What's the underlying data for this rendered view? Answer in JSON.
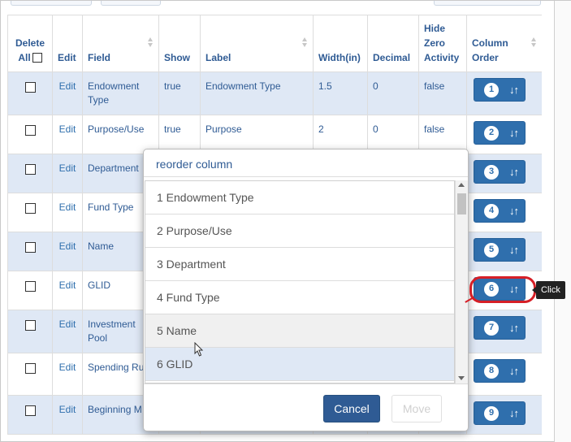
{
  "table": {
    "headers": {
      "delete": "Delete",
      "delete_all": "All",
      "edit": "Edit",
      "field": "Field",
      "show": "Show",
      "label": "Label",
      "width": "Width(in)",
      "decimal": "Decimal",
      "hide_zero": "Hide Zero Activity",
      "column_order": "Column Order"
    },
    "edit_link": "Edit",
    "rows": [
      {
        "field": "Endowment Type",
        "show": "true",
        "label": "Endowment Type",
        "width": "1.5",
        "decimal": "0",
        "hide_zero": "false",
        "order": "1"
      },
      {
        "field": "Purpose/Use",
        "show": "true",
        "label": "Purpose",
        "width": "2",
        "decimal": "0",
        "hide_zero": "false",
        "order": "2"
      },
      {
        "field": "Department",
        "show": "",
        "label": "",
        "width": "",
        "decimal": "",
        "hide_zero": "",
        "order": "3"
      },
      {
        "field": "Fund Type",
        "show": "",
        "label": "",
        "width": "",
        "decimal": "",
        "hide_zero": "",
        "order": "4"
      },
      {
        "field": "Name",
        "show": "",
        "label": "",
        "width": "",
        "decimal": "",
        "hide_zero": "",
        "order": "5"
      },
      {
        "field": "GLID",
        "show": "",
        "label": "",
        "width": "",
        "decimal": "",
        "hide_zero": "",
        "order": "6"
      },
      {
        "field": "Investment Pool",
        "show": "",
        "label": "",
        "width": "",
        "decimal": "",
        "hide_zero": "",
        "order": "7"
      },
      {
        "field": "Spending Rule",
        "show": "",
        "label": "",
        "width": "",
        "decimal": "",
        "hide_zero": "",
        "order": "8"
      },
      {
        "field": "Beginning M",
        "show": "",
        "label": "",
        "width": "",
        "decimal": "",
        "hide_zero": "",
        "order": "9"
      }
    ],
    "order_icon": "sort-arrows-icon"
  },
  "modal": {
    "title": "reorder column",
    "items": [
      "1 Endowment Type",
      "2 Purpose/Use",
      "3 Department",
      "4 Fund Type",
      "5 Name",
      "6 GLID"
    ],
    "cancel_label": "Cancel",
    "move_label": "Move"
  },
  "tooltip": {
    "text": "Click"
  },
  "colors": {
    "primary": "#2f6fad",
    "row_stripe": "#dfe8f5",
    "header_text": "#2f5b94",
    "callout": "#d61f26"
  }
}
